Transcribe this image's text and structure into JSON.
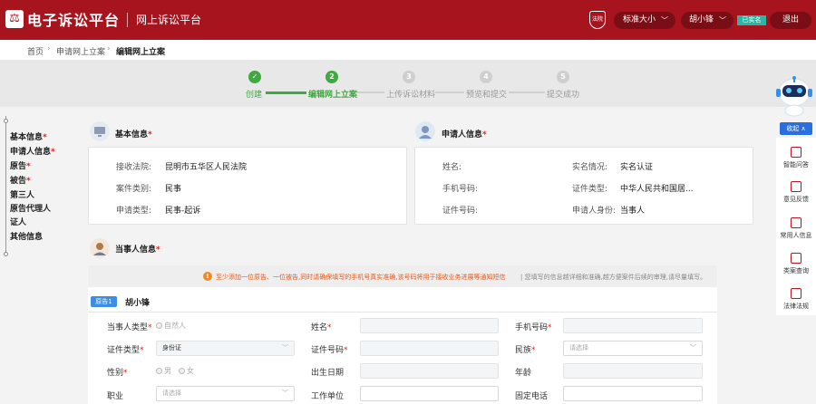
{
  "header": {
    "site_title": "电子诉讼平台",
    "sub_title": "网上诉讼平台",
    "badge_text": "法院",
    "font_size_label": "标准大小",
    "user_name": "胡小锋",
    "verified": "已实名",
    "logout": "退出"
  },
  "breadcrumb": [
    "首页",
    "申请网上立案",
    "编辑网上立案"
  ],
  "steps": [
    {
      "num": "✓",
      "label": "创建",
      "state": "done"
    },
    {
      "num": "2",
      "label": "编辑网上立案",
      "state": "active"
    },
    {
      "num": "3",
      "label": "上传诉讼材料",
      "state": "todo"
    },
    {
      "num": "4",
      "label": "预览和提交",
      "state": "todo"
    },
    {
      "num": "5",
      "label": "提交成功",
      "state": "todo"
    }
  ],
  "leftnav": [
    {
      "label": "基本信息",
      "req": "*"
    },
    {
      "label": "申请人信息",
      "req": "*"
    },
    {
      "label": "原告",
      "req": "*"
    },
    {
      "label": "被告",
      "req": "*"
    },
    {
      "label": "第三人",
      "req": ""
    },
    {
      "label": "原告代理人",
      "req": ""
    },
    {
      "label": "证人",
      "req": ""
    },
    {
      "label": "其他信息",
      "req": ""
    }
  ],
  "basic": {
    "title": "基本信息",
    "court_label": "接收法院:",
    "court_value": "昆明市五华区人民法院",
    "case_type_label": "案件类别:",
    "case_type_value": "民事",
    "apply_type_label": "申请类型:",
    "apply_type_value": "民事-起诉"
  },
  "applicant": {
    "title": "申请人信息",
    "name_label": "姓名:",
    "realname_label": "实名情况:",
    "realname_value": "实名认证",
    "phone_label": "手机号码:",
    "idtype_label": "证件类型:",
    "idtype_value": "中华人民共和国居...",
    "idno_label": "证件号码:",
    "identity_label": "申请人身份:",
    "identity_value": "当事人"
  },
  "party": {
    "title": "当事人信息",
    "warn": "至少添加一位原告、一位被告,同时请确保填写的手机号真实准确,该号码将用于接收业务进展等通知短信",
    "hint": "| 您填写的信息越详细和准确,越方便案件后续的审理,请尽量填写。",
    "tab": "原告1",
    "name": "胡小锋",
    "fields": {
      "type_label": "当事人类型",
      "type_value": "自然人",
      "name_label": "姓名",
      "phone_label": "手机号码",
      "idtype_label": "证件类型",
      "idtype_value": "身份证",
      "idno_label": "证件号码",
      "ethnic_label": "民族",
      "ethnic_placeholder": "请选择",
      "gender_label": "性别",
      "gender_male": "男",
      "gender_female": "女",
      "birth_label": "出生日期",
      "age_label": "年龄",
      "job_label": "职业",
      "job_placeholder": "请选择",
      "work_label": "工作单位",
      "tel_label": "固定电话"
    }
  },
  "sidebar": {
    "collapse": "收起 ∧",
    "items": [
      "智能问答",
      "意见反馈",
      "常用人信息",
      "类案查询",
      "法律法规"
    ]
  },
  "colors": {
    "brand": "#a8141e",
    "green": "#3faa3f",
    "blue": "#2a6fe0"
  }
}
